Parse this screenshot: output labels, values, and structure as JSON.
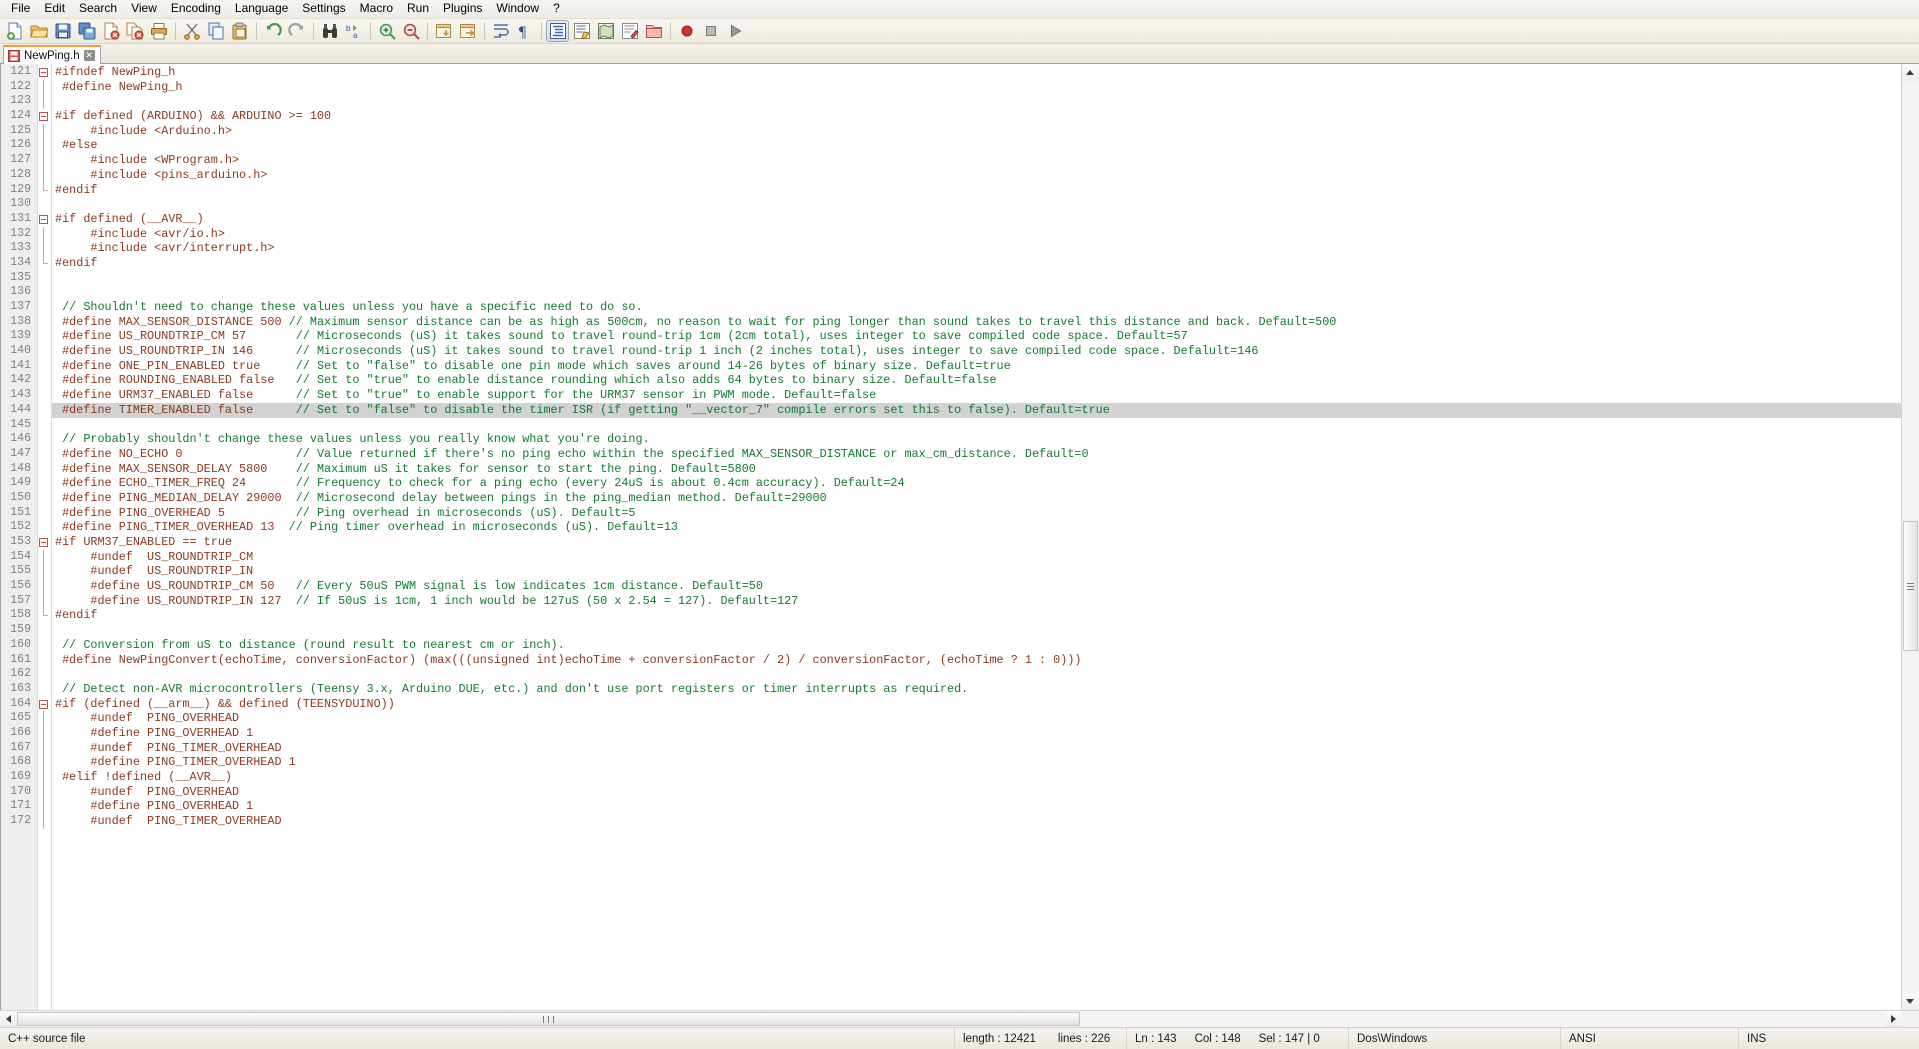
{
  "app": {
    "name": "Notepad++"
  },
  "menubar": {
    "items": [
      {
        "label": "File",
        "name": "menu-file"
      },
      {
        "label": "Edit",
        "name": "menu-edit"
      },
      {
        "label": "Search",
        "name": "menu-search"
      },
      {
        "label": "View",
        "name": "menu-view"
      },
      {
        "label": "Encoding",
        "name": "menu-encoding"
      },
      {
        "label": "Language",
        "name": "menu-language"
      },
      {
        "label": "Settings",
        "name": "menu-settings"
      },
      {
        "label": "Macro",
        "name": "menu-macro"
      },
      {
        "label": "Run",
        "name": "menu-run"
      },
      {
        "label": "Plugins",
        "name": "menu-plugins"
      },
      {
        "label": "Window",
        "name": "menu-window"
      },
      {
        "label": "?",
        "name": "menu-help"
      }
    ]
  },
  "toolbar": {
    "buttons": [
      {
        "icon": "new-file-icon",
        "tip": "New"
      },
      {
        "icon": "open-folder-icon",
        "tip": "Open"
      },
      {
        "icon": "save-icon",
        "tip": "Save"
      },
      {
        "icon": "save-all-icon",
        "tip": "Save All"
      },
      {
        "icon": "close-file-icon",
        "tip": "Close"
      },
      {
        "icon": "close-all-icon",
        "tip": "Close All"
      },
      {
        "icon": "print-icon",
        "tip": "Print"
      },
      {
        "icon": "separator",
        "tip": ""
      },
      {
        "icon": "cut-scissors-icon",
        "tip": "Cut"
      },
      {
        "icon": "copy-icon",
        "tip": "Copy"
      },
      {
        "icon": "paste-icon",
        "tip": "Paste"
      },
      {
        "icon": "separator",
        "tip": ""
      },
      {
        "icon": "undo-icon",
        "tip": "Undo"
      },
      {
        "icon": "redo-icon",
        "tip": "Redo"
      },
      {
        "icon": "separator",
        "tip": ""
      },
      {
        "icon": "find-binoculars-icon",
        "tip": "Find"
      },
      {
        "icon": "replace-icon",
        "tip": "Replace"
      },
      {
        "icon": "separator",
        "tip": ""
      },
      {
        "icon": "zoom-in-icon",
        "tip": "Zoom In"
      },
      {
        "icon": "zoom-out-icon",
        "tip": "Zoom Out"
      },
      {
        "icon": "separator",
        "tip": ""
      },
      {
        "icon": "sync-vertical-icon",
        "tip": "Synchronize Vertical Scrolling"
      },
      {
        "icon": "sync-horizontal-icon",
        "tip": "Synchronize Horizontal Scrolling"
      },
      {
        "icon": "separator",
        "tip": ""
      },
      {
        "icon": "word-wrap-icon",
        "tip": "Word wrap"
      },
      {
        "icon": "show-all-chars-icon",
        "tip": "Show All Characters"
      },
      {
        "icon": "separator",
        "tip": ""
      },
      {
        "icon": "indent-guide-icon",
        "tip": "Show Indent Guide"
      },
      {
        "icon": "user-define-dialog-icon",
        "tip": "User-Defined Dialogue"
      },
      {
        "icon": "doc-map-icon",
        "tip": "Document Map"
      },
      {
        "icon": "function-list-icon",
        "tip": "Function List"
      },
      {
        "icon": "folder-workspace-icon",
        "tip": "Folder as Workspace"
      },
      {
        "icon": "separator",
        "tip": ""
      },
      {
        "icon": "record-macro-icon",
        "tip": "Start Recording"
      },
      {
        "icon": "stop-macro-icon",
        "tip": "Stop Recording"
      },
      {
        "icon": "play-macro-icon",
        "tip": "Playback"
      }
    ]
  },
  "tabs": [
    {
      "label": "NewPing.h",
      "icon": "saved-doc-icon",
      "close": "✕",
      "active": true
    }
  ],
  "editor": {
    "first_line": 121,
    "selected_line": 143,
    "lines": [
      {
        "n": 121,
        "fold": "open",
        "tokens": [
          {
            "t": "pp",
            "s": "#ifndef NewPing_h"
          }
        ]
      },
      {
        "n": 122,
        "fold": "bar",
        "tokens": [
          {
            "t": "pp",
            "s": " #define NewPing_h"
          }
        ]
      },
      {
        "n": 123,
        "fold": "bar",
        "tokens": [
          {
            "t": "txt",
            "s": ""
          }
        ]
      },
      {
        "n": 124,
        "fold": "open",
        "tokens": [
          {
            "t": "pp",
            "s": "#if defined (ARDUINO) && ARDUINO >= 100"
          }
        ]
      },
      {
        "n": 125,
        "fold": "bar",
        "tokens": [
          {
            "t": "pp",
            "s": "     #include <Arduino.h>"
          }
        ]
      },
      {
        "n": 126,
        "fold": "bar",
        "tokens": [
          {
            "t": "pp",
            "s": " #else"
          }
        ]
      },
      {
        "n": 127,
        "fold": "bar",
        "tokens": [
          {
            "t": "pp",
            "s": "     #include <WProgram.h>"
          }
        ]
      },
      {
        "n": 128,
        "fold": "bar",
        "tokens": [
          {
            "t": "pp",
            "s": "     #include <pins_arduino.h>"
          }
        ]
      },
      {
        "n": 129,
        "fold": "close",
        "tokens": [
          {
            "t": "pp",
            "s": "#endif"
          }
        ]
      },
      {
        "n": 130,
        "fold": "none",
        "tokens": [
          {
            "t": "txt",
            "s": ""
          }
        ]
      },
      {
        "n": 131,
        "fold": "open",
        "tokens": [
          {
            "t": "pp",
            "s": "#if defined (__AVR__)"
          }
        ]
      },
      {
        "n": 132,
        "fold": "bar",
        "tokens": [
          {
            "t": "pp",
            "s": "     #include <avr/io.h>"
          }
        ]
      },
      {
        "n": 133,
        "fold": "bar",
        "tokens": [
          {
            "t": "pp",
            "s": "     #include <avr/interrupt.h>"
          }
        ]
      },
      {
        "n": 134,
        "fold": "close",
        "tokens": [
          {
            "t": "pp",
            "s": "#endif"
          }
        ]
      },
      {
        "n": 135,
        "fold": "none",
        "tokens": [
          {
            "t": "txt",
            "s": ""
          }
        ]
      },
      {
        "n": 136,
        "fold": "none",
        "tokens": [
          {
            "t": "txt",
            "s": ""
          }
        ]
      },
      {
        "n": 137,
        "fold": "none",
        "tokens": [
          {
            "t": "cmt",
            "s": " // Shouldn't need to change these values unless you have a specific need to do so."
          }
        ]
      },
      {
        "n": 138,
        "fold": "none",
        "tokens": [
          {
            "t": "pp",
            "s": " #define MAX_SENSOR_DISTANCE 500 "
          },
          {
            "t": "cmt",
            "s": "// Maximum sensor distance can be as high as 500cm, no reason to wait for ping longer than sound takes to travel this distance and back. Default=500"
          }
        ]
      },
      {
        "n": 139,
        "fold": "none",
        "tokens": [
          {
            "t": "pp",
            "s": " #define US_ROUNDTRIP_CM 57       "
          },
          {
            "t": "cmt",
            "s": "// Microseconds (uS) it takes sound to travel round-trip 1cm (2cm total), uses integer to save compiled code space. Default=57"
          }
        ]
      },
      {
        "n": 140,
        "fold": "none",
        "tokens": [
          {
            "t": "pp",
            "s": " #define US_ROUNDTRIP_IN 146      "
          },
          {
            "t": "cmt",
            "s": "// Microseconds (uS) it takes sound to travel round-trip 1 inch (2 inches total), uses integer to save compiled code space. Defalult=146"
          }
        ]
      },
      {
        "n": 141,
        "fold": "none",
        "tokens": [
          {
            "t": "pp",
            "s": " #define ONE_PIN_ENABLED true     "
          },
          {
            "t": "cmt",
            "s": "// Set to \"false\" to disable one pin mode which saves around 14-26 bytes of binary size. Default=true"
          }
        ]
      },
      {
        "n": 142,
        "fold": "none",
        "tokens": [
          {
            "t": "pp",
            "s": " #define ROUNDING_ENABLED false   "
          },
          {
            "t": "cmt",
            "s": "// Set to \"true\" to enable distance rounding which also adds 64 bytes to binary size. Default=false"
          }
        ]
      },
      {
        "n": 143,
        "fold": "none",
        "tokens": [
          {
            "t": "pp",
            "s": " #define URM37_ENABLED false      "
          },
          {
            "t": "cmt",
            "s": "// Set to \"true\" to enable support for the URM37 sensor in PWM mode. Default=false"
          }
        ]
      },
      {
        "n": 144,
        "fold": "none",
        "sel": true,
        "tokens": [
          {
            "t": "pp",
            "s": " #define TIMER_ENABLED false      "
          },
          {
            "t": "cmt",
            "s": "// Set to \"false\" to disable the timer ISR (if getting \"__vector_7\" compile errors set this to false). Default=true"
          }
        ]
      },
      {
        "n": 145,
        "fold": "none",
        "tokens": [
          {
            "t": "txt",
            "s": ""
          }
        ]
      },
      {
        "n": 146,
        "fold": "none",
        "tokens": [
          {
            "t": "cmt",
            "s": " // Probably shouldn't change these values unless you really know what you're doing."
          }
        ]
      },
      {
        "n": 147,
        "fold": "none",
        "tokens": [
          {
            "t": "pp",
            "s": " #define NO_ECHO 0                "
          },
          {
            "t": "cmt",
            "s": "// Value returned if there's no ping echo within the specified MAX_SENSOR_DISTANCE or max_cm_distance. Default=0"
          }
        ]
      },
      {
        "n": 148,
        "fold": "none",
        "tokens": [
          {
            "t": "pp",
            "s": " #define MAX_SENSOR_DELAY 5800    "
          },
          {
            "t": "cmt",
            "s": "// Maximum uS it takes for sensor to start the ping. Default=5800"
          }
        ]
      },
      {
        "n": 149,
        "fold": "none",
        "tokens": [
          {
            "t": "pp",
            "s": " #define ECHO_TIMER_FREQ 24       "
          },
          {
            "t": "cmt",
            "s": "// Frequency to check for a ping echo (every 24uS is about 0.4cm accuracy). Default=24"
          }
        ]
      },
      {
        "n": 150,
        "fold": "none",
        "tokens": [
          {
            "t": "pp",
            "s": " #define PING_MEDIAN_DELAY 29000  "
          },
          {
            "t": "cmt",
            "s": "// Microsecond delay between pings in the ping_median method. Default=29000"
          }
        ]
      },
      {
        "n": 151,
        "fold": "none",
        "tokens": [
          {
            "t": "pp",
            "s": " #define PING_OVERHEAD 5          "
          },
          {
            "t": "cmt",
            "s": "// Ping overhead in microseconds (uS). Default=5"
          }
        ]
      },
      {
        "n": 152,
        "fold": "none",
        "tokens": [
          {
            "t": "pp",
            "s": " #define PING_TIMER_OVERHEAD 13  "
          },
          {
            "t": "cmt",
            "s": "// Ping timer overhead in microseconds (uS). Default=13"
          }
        ]
      },
      {
        "n": 153,
        "fold": "open",
        "tokens": [
          {
            "t": "pp",
            "s": "#if URM37_ENABLED == true"
          }
        ]
      },
      {
        "n": 154,
        "fold": "bar",
        "tokens": [
          {
            "t": "pp",
            "s": "     #undef  US_ROUNDTRIP_CM"
          }
        ]
      },
      {
        "n": 155,
        "fold": "bar",
        "tokens": [
          {
            "t": "pp",
            "s": "     #undef  US_ROUNDTRIP_IN"
          }
        ]
      },
      {
        "n": 156,
        "fold": "bar",
        "tokens": [
          {
            "t": "pp",
            "s": "     #define US_ROUNDTRIP_CM 50   "
          },
          {
            "t": "cmt",
            "s": "// Every 50uS PWM signal is low indicates 1cm distance. Default=50"
          }
        ]
      },
      {
        "n": 157,
        "fold": "bar",
        "tokens": [
          {
            "t": "pp",
            "s": "     #define US_ROUNDTRIP_IN 127  "
          },
          {
            "t": "cmt",
            "s": "// If 50uS is 1cm, 1 inch would be 127uS (50 x 2.54 = 127). Default=127"
          }
        ]
      },
      {
        "n": 158,
        "fold": "close",
        "tokens": [
          {
            "t": "pp",
            "s": "#endif"
          }
        ]
      },
      {
        "n": 159,
        "fold": "none",
        "tokens": [
          {
            "t": "txt",
            "s": ""
          }
        ]
      },
      {
        "n": 160,
        "fold": "none",
        "tokens": [
          {
            "t": "cmt",
            "s": " // Conversion from uS to distance (round result to nearest cm or inch)."
          }
        ]
      },
      {
        "n": 161,
        "fold": "none",
        "tokens": [
          {
            "t": "pp",
            "s": " #define NewPingConvert(echoTime, conversionFactor) (max(((unsigned int)echoTime + conversionFactor / 2) / conversionFactor, (echoTime ? 1 : 0)))"
          }
        ]
      },
      {
        "n": 162,
        "fold": "none",
        "tokens": [
          {
            "t": "txt",
            "s": ""
          }
        ]
      },
      {
        "n": 163,
        "fold": "none",
        "tokens": [
          {
            "t": "cmt",
            "s": " // Detect non-AVR microcontrollers (Teensy 3.x, Arduino DUE, etc.) and don't use port registers or timer interrupts as required."
          }
        ]
      },
      {
        "n": 164,
        "fold": "open",
        "tokens": [
          {
            "t": "pp",
            "s": "#if (defined (__arm__) && defined (TEENSYDUINO))"
          }
        ]
      },
      {
        "n": 165,
        "fold": "bar",
        "tokens": [
          {
            "t": "pp",
            "s": "     #undef  PING_OVERHEAD"
          }
        ]
      },
      {
        "n": 166,
        "fold": "bar",
        "tokens": [
          {
            "t": "pp",
            "s": "     #define PING_OVERHEAD 1"
          }
        ]
      },
      {
        "n": 167,
        "fold": "bar",
        "tokens": [
          {
            "t": "pp",
            "s": "     #undef  PING_TIMER_OVERHEAD"
          }
        ]
      },
      {
        "n": 168,
        "fold": "bar",
        "tokens": [
          {
            "t": "pp",
            "s": "     #define PING_TIMER_OVERHEAD 1"
          }
        ]
      },
      {
        "n": 169,
        "fold": "bar",
        "tokens": [
          {
            "t": "pp",
            "s": " #elif !defined (__AVR__)"
          }
        ]
      },
      {
        "n": 170,
        "fold": "bar",
        "tokens": [
          {
            "t": "pp",
            "s": "     #undef  PING_OVERHEAD"
          }
        ]
      },
      {
        "n": 171,
        "fold": "bar",
        "tokens": [
          {
            "t": "pp",
            "s": "     #define PING_OVERHEAD 1"
          }
        ]
      },
      {
        "n": 172,
        "fold": "bar",
        "tokens": [
          {
            "t": "pp",
            "s": "     #undef  PING_TIMER_OVERHEAD"
          }
        ]
      }
    ]
  },
  "statusbar": {
    "doc_type": "C++ source file",
    "length_label": "length : 12421",
    "lines_label": "lines : 226",
    "ln_label": "Ln : 143",
    "col_label": "Col : 148",
    "sel_label": "Sel : 147 | 0",
    "eol": "Dos\\Windows",
    "encoding": "ANSI",
    "insert_mode": "INS"
  },
  "colors": {
    "preprocessor": "#8b3a1e",
    "comment": "#107c30",
    "selection": "#d2d2d2",
    "tab_accent": "#e8a33d",
    "gutter_bg": "#eeeeee"
  }
}
